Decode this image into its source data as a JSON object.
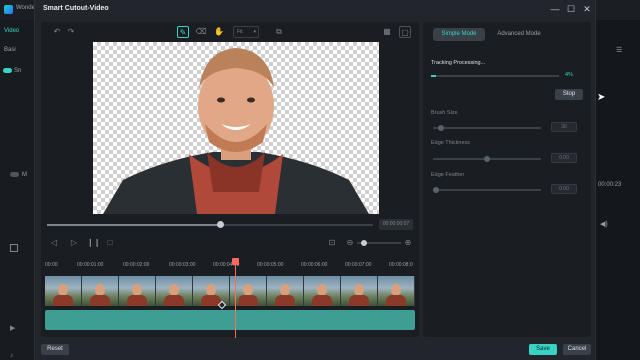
{
  "app": {
    "title_fragment": "Wonde",
    "timecode": "00:00:23"
  },
  "bg_left": {
    "tab": "Video",
    "sub": "Basi",
    "toggle_s": "Sn",
    "toggle_m": "M"
  },
  "dialog": {
    "title": "Smart Cutout-Video",
    "preview": {
      "time": "00:00:00:07",
      "scrub_progress": 0.53
    },
    "timeline": {
      "ticks": [
        "00:00",
        "00:00:01:00",
        "00:00:02:00",
        "00:00:03:00",
        "00:00:04:00",
        "00:00:05:00",
        "00:00:06:00",
        "00:00:07:00",
        "00:00:08:0"
      ],
      "frame_count": 10
    },
    "settings": {
      "modes": [
        {
          "label": "Simple Mode",
          "active": true
        },
        {
          "label": "Advanced Mode",
          "active": false
        }
      ],
      "tracking": {
        "label": "Tracking Processing...",
        "percent_text": "4%",
        "progress": 0.04
      },
      "stop_label": "Stop",
      "brush_size": {
        "label": "Brush Size",
        "value": "30",
        "level": 0.05
      },
      "edge_thickness": {
        "label": "Edge Thickness",
        "value": "0.00",
        "level": 0.5
      },
      "edge_feather": {
        "label": "Edge Feather",
        "value": "0.00",
        "level": 0.0
      }
    },
    "buttons": {
      "reset": "Reset",
      "save": "Save",
      "cancel": "Cancel"
    },
    "toolbar": {
      "fit_label": "Fit"
    }
  },
  "colors": {
    "accent": "#39d3c2",
    "playhead": "#ff6a5c",
    "mask": "#3e9e93"
  }
}
